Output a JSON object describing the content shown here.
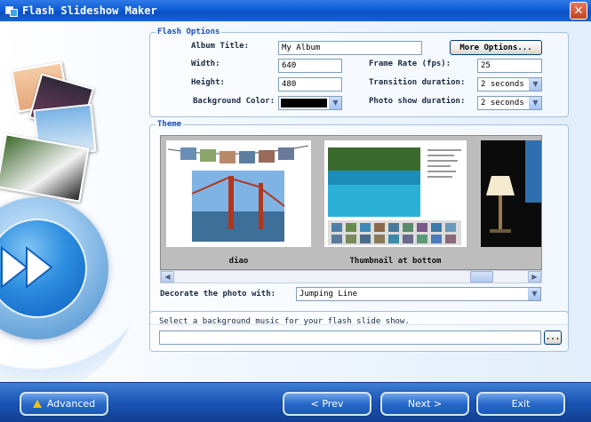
{
  "window": {
    "title": "Flash Slideshow Maker",
    "close_glyph": "✕"
  },
  "flash_options": {
    "legend": "Flash Options",
    "album_title_label": "Album Title:",
    "album_title_value": "My Album",
    "more_options_label": "More Options...",
    "width_label": "Width:",
    "width_value": "640",
    "height_label": "Height:",
    "height_value": "480",
    "bg_color_label": "Background Color:",
    "bg_color_value": "#000000",
    "frame_rate_label": "Frame Rate (fps):",
    "frame_rate_value": "25",
    "transition_label": "Transition duration:",
    "transition_value": "2 seconds",
    "photo_show_label": "Photo show duration:",
    "photo_show_value": "2 seconds"
  },
  "theme": {
    "legend": "Theme",
    "thumbnails": [
      {
        "caption": "diao"
      },
      {
        "caption": "Thumbnail at bottom"
      },
      {
        "caption": ""
      }
    ],
    "decorate_label": "Decorate the photo with:",
    "decorate_value": "Jumping Line"
  },
  "music": {
    "prompt": "Select a background music for your flash slide show.",
    "path_value": "",
    "browse_label": "..."
  },
  "footer": {
    "advanced_label": "Advanced",
    "prev_label": "< Prev",
    "next_label": "Next >",
    "exit_label": "Exit"
  },
  "icons": {
    "dropdown_arrow": "▼",
    "scroll_left": "◀",
    "scroll_right": "▶"
  },
  "colors": {
    "titlebar": "#0d5cd6",
    "accent_blue": "#1d4fb0",
    "footer_blue": "#1a55b5",
    "warning_yellow": "#f4c21a"
  }
}
